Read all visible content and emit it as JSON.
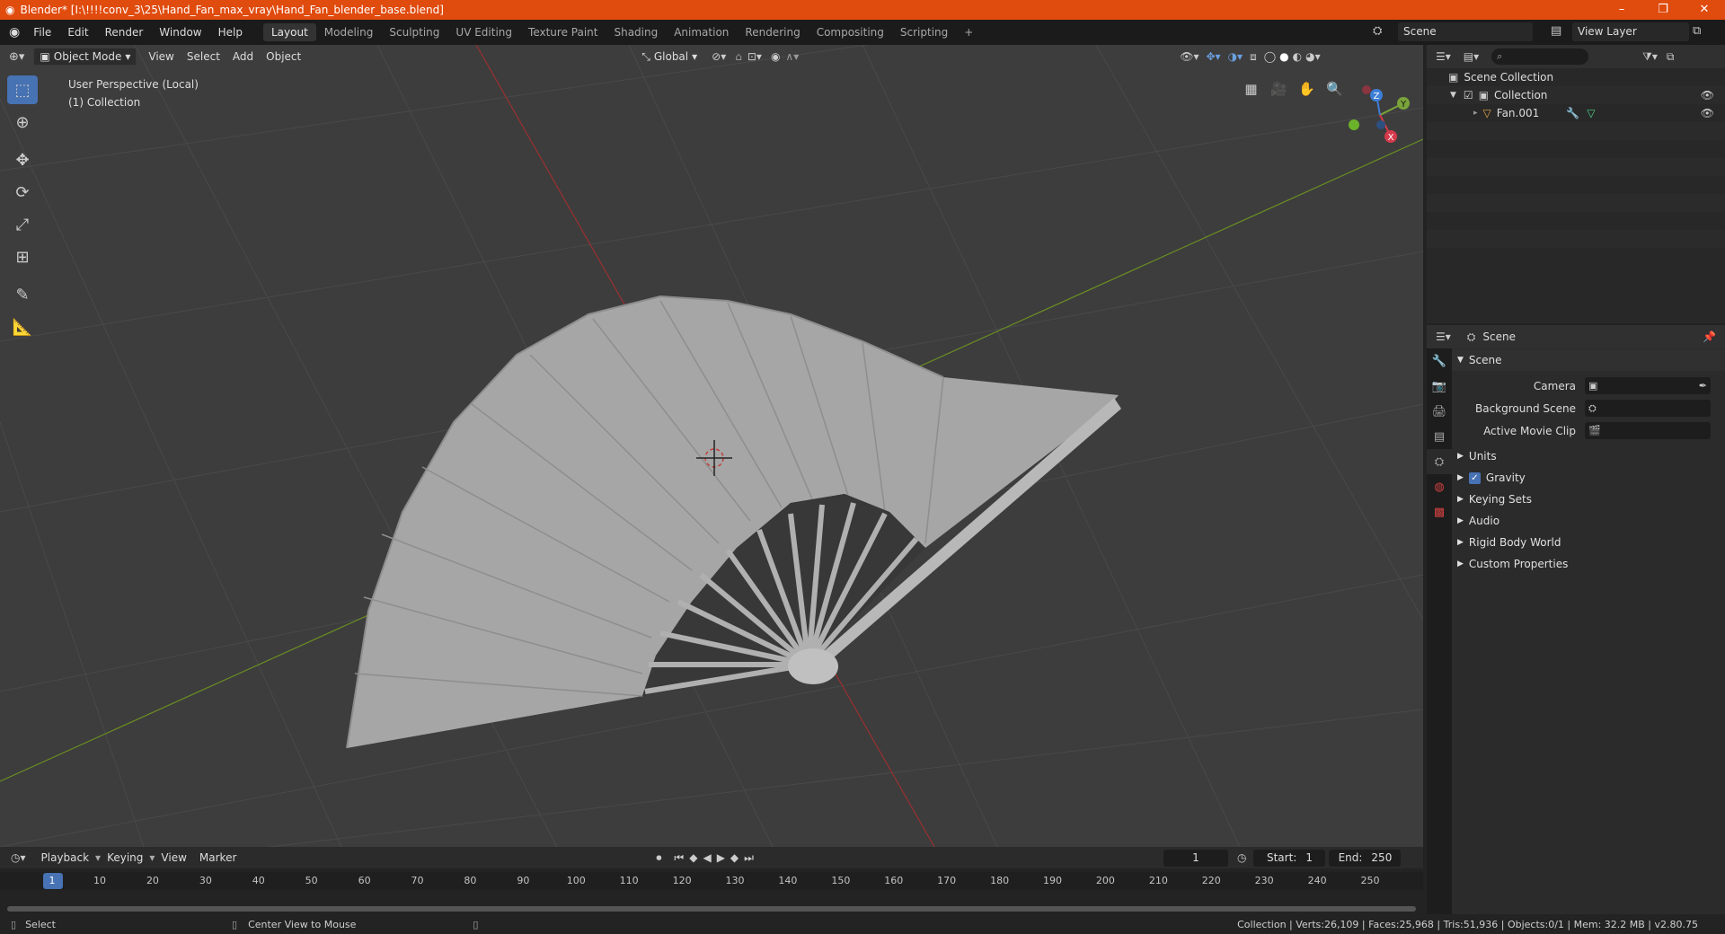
{
  "window": {
    "title": "Blender* [I:\\!!!!conv_3\\25\\Hand_Fan_max_vray\\Hand_Fan_blender_base.blend]",
    "minimize": "–",
    "maximize": "❐",
    "close": "✕"
  },
  "menu": [
    "File",
    "Edit",
    "Render",
    "Window",
    "Help"
  ],
  "workspaces": [
    "Layout",
    "Modeling",
    "Sculpting",
    "UV Editing",
    "Texture Paint",
    "Shading",
    "Animation",
    "Rendering",
    "Compositing",
    "Scripting",
    "+"
  ],
  "active_workspace": "Layout",
  "scene_name": "Scene",
  "view_layer": "View Layer",
  "viewport_header": {
    "mode": "Object Mode",
    "view": "View",
    "select": "Select",
    "add": "Add",
    "object": "Object",
    "orientation": "Global"
  },
  "viewport_info": {
    "perspective": "User Perspective (Local)",
    "collection": "(1) Collection"
  },
  "gizmo_axes": {
    "z": "Z",
    "y": "Y",
    "x": "X"
  },
  "outliner": {
    "root": "Scene Collection",
    "collection": "Collection",
    "object": "Fan.001"
  },
  "properties": {
    "header": "Scene",
    "panel": "Scene",
    "camera_label": "Camera",
    "background_scene_label": "Background Scene",
    "active_movie_clip_label": "Active Movie Clip",
    "sections": [
      "Units",
      "Gravity",
      "Keying Sets",
      "Audio",
      "Rigid Body World",
      "Custom Properties"
    ]
  },
  "timeline": {
    "playback": "Playback",
    "keying": "Keying",
    "view": "View",
    "marker": "Marker",
    "current_frame": "1",
    "start_label": "Start:",
    "start": "1",
    "end_label": "End:",
    "end": "250",
    "ruler": [
      "1",
      "10",
      "20",
      "30",
      "40",
      "50",
      "60",
      "70",
      "80",
      "90",
      "100",
      "110",
      "120",
      "130",
      "140",
      "150",
      "160",
      "170",
      "180",
      "190",
      "200",
      "210",
      "220",
      "230",
      "240",
      "250"
    ]
  },
  "statusbar": {
    "left_action": "Select",
    "mid_action": "Center View to Mouse",
    "stats": "Collection | Verts:26,109 | Faces:25,968 | Tris:51,936 | Objects:0/1 | Mem: 32.2 MB | v2.80.75"
  }
}
